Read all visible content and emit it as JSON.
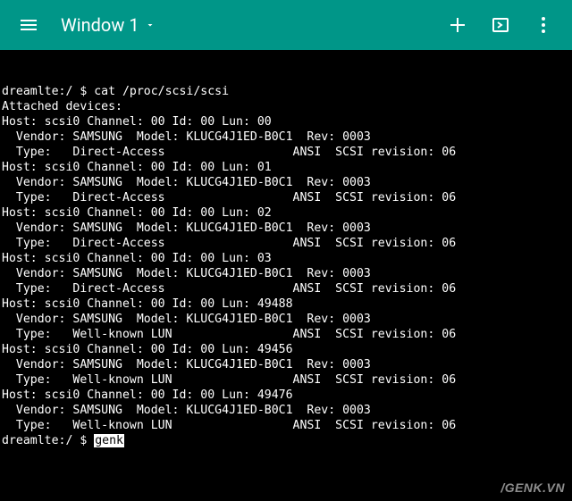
{
  "appbar": {
    "title": "Window 1",
    "accent_color": "#009688"
  },
  "terminal": {
    "prompt_host": "dreamlte:/",
    "prompt_symbol": "$",
    "command": "cat /proc/scsi/scsi",
    "header": "Attached devices:",
    "devices": [
      {
        "host": "scsi0",
        "channel": "00",
        "id": "00",
        "lun": "00",
        "vendor": "SAMSUNG",
        "model": "KLUCG4J1ED-B0C1",
        "rev": "0003",
        "type": "Direct-Access",
        "ansi_rev": "06"
      },
      {
        "host": "scsi0",
        "channel": "00",
        "id": "00",
        "lun": "01",
        "vendor": "SAMSUNG",
        "model": "KLUCG4J1ED-B0C1",
        "rev": "0003",
        "type": "Direct-Access",
        "ansi_rev": "06"
      },
      {
        "host": "scsi0",
        "channel": "00",
        "id": "00",
        "lun": "02",
        "vendor": "SAMSUNG",
        "model": "KLUCG4J1ED-B0C1",
        "rev": "0003",
        "type": "Direct-Access",
        "ansi_rev": "06"
      },
      {
        "host": "scsi0",
        "channel": "00",
        "id": "00",
        "lun": "03",
        "vendor": "SAMSUNG",
        "model": "KLUCG4J1ED-B0C1",
        "rev": "0003",
        "type": "Direct-Access",
        "ansi_rev": "06"
      },
      {
        "host": "scsi0",
        "channel": "00",
        "id": "00",
        "lun": "49488",
        "vendor": "SAMSUNG",
        "model": "KLUCG4J1ED-B0C1",
        "rev": "0003",
        "type": "Well-known LUN",
        "ansi_rev": "06"
      },
      {
        "host": "scsi0",
        "channel": "00",
        "id": "00",
        "lun": "49456",
        "vendor": "SAMSUNG",
        "model": "KLUCG4J1ED-B0C1",
        "rev": "0003",
        "type": "Well-known LUN",
        "ansi_rev": "06"
      },
      {
        "host": "scsi0",
        "channel": "00",
        "id": "00",
        "lun": "49476",
        "vendor": "SAMSUNG",
        "model": "KLUCG4J1ED-B0C1",
        "rev": "0003",
        "type": "Well-known LUN",
        "ansi_rev": "06"
      }
    ],
    "current_input": "genk"
  },
  "watermark": "/GENK.VN"
}
